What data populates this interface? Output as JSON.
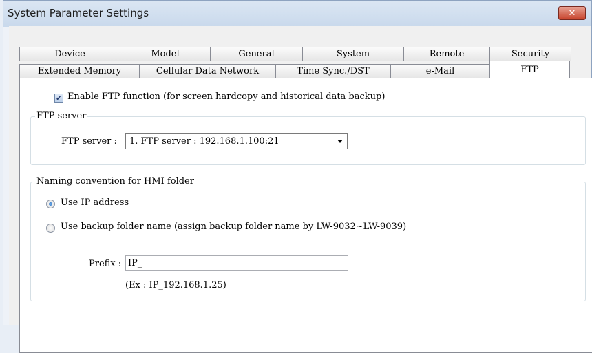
{
  "window": {
    "title": "System Parameter Settings",
    "close_symbol": "✕"
  },
  "tabs": {
    "back_row": [
      "Device",
      "Model",
      "General",
      "System",
      "Remote",
      "Security"
    ],
    "front_row": [
      "Extended Memory",
      "Cellular Data Network",
      "Time Sync./DST",
      "e-Mail",
      "FTP"
    ],
    "active": "FTP"
  },
  "ftp": {
    "enable_label": "Enable FTP function (for screen hardcopy and historical data backup)",
    "enable_checked": true,
    "server_group_title": "FTP server",
    "server_label": "FTP server :",
    "server_value": "1. FTP server : 192.168.1.100:21",
    "naming_group_title": "Naming convention for HMI folder",
    "radio_ip_label": "Use IP address",
    "radio_folder_label": "Use backup folder name (assign backup folder name by LW-9032~LW-9039)",
    "selected_option": "Use IP address",
    "prefix_label": "Prefix :",
    "prefix_value": "IP_",
    "example_text": "(Ex : IP_192.168.1.25)"
  }
}
